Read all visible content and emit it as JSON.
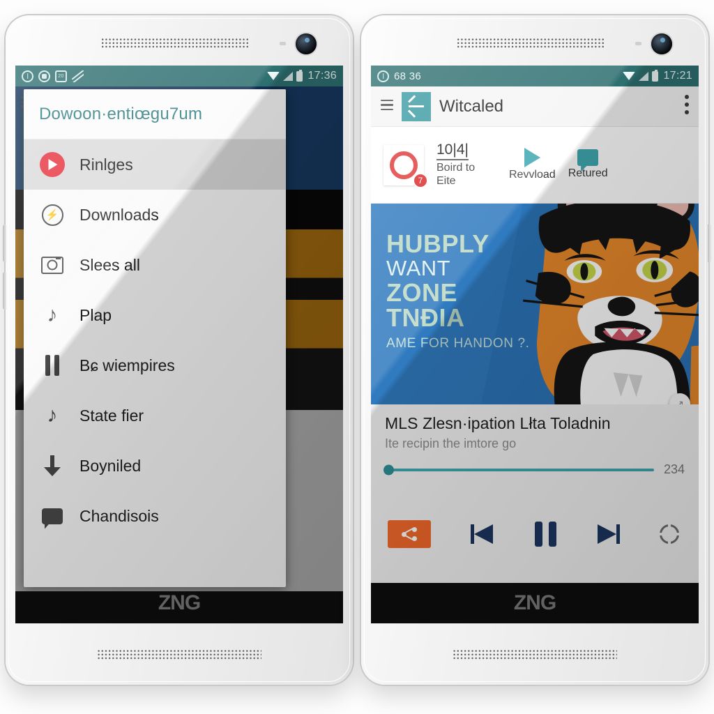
{
  "brand": "ZNG",
  "left_phone": {
    "status_bar": {
      "notification_icons": [
        "compass-icon",
        "sync-icon",
        "calendar-icon",
        "mute-icon"
      ],
      "wifi_icon": "wifi-icon",
      "signal_icon": "signal-icon",
      "battery_icon": "battery-icon",
      "time": "17:36"
    },
    "drawer": {
      "title": "Dowoon·entiœgu7um",
      "items": [
        {
          "label": "Rinlges",
          "icon": "play-circle-icon",
          "active": true
        },
        {
          "label": "Downloads",
          "icon": "bolt-circle-icon",
          "active": false
        },
        {
          "label": "Slees all",
          "icon": "camera-icon",
          "active": false
        },
        {
          "label": "Plap",
          "icon": "music-note-icon",
          "active": false
        },
        {
          "label": "Bɕ wiempires",
          "icon": "pause-icon",
          "active": false
        },
        {
          "label": "State fier",
          "icon": "music-note-icon",
          "active": false
        },
        {
          "label": "Boyniled",
          "icon": "download-arrow-icon",
          "active": false
        },
        {
          "label": "Chandisois",
          "icon": "chat-bubble-icon",
          "active": false
        }
      ]
    },
    "nav_bar": {
      "back": "back-triangle-icon",
      "home": "home-circle-icon",
      "recents": "recents-square-icon"
    }
  },
  "right_phone": {
    "status_bar": {
      "notification_icons": [
        "compass-icon"
      ],
      "notification_count": "68 36",
      "wifi_icon": "wifi-icon",
      "signal_icon": "signal-icon",
      "battery_icon": "battery-icon",
      "time": "17:21"
    },
    "toolbar": {
      "menu_icon": "hamburger-icon",
      "back_icon": "arrow-left-icon",
      "title": "Witcaled",
      "overflow_icon": "more-vertical-icon"
    },
    "action_row": {
      "thumbnail_icon": "red-loop-icon",
      "thumbnail_badge": "7",
      "primary_value": "10|4|",
      "primary_label": "Boird to Eite",
      "actions": [
        {
          "label": "Revvload",
          "icon": "play-triangle-icon"
        },
        {
          "label": "Retured",
          "icon": "chat-bubble-icon"
        }
      ]
    },
    "hero": {
      "lines": [
        "HUBPLY",
        "WANT",
        "ZONE",
        "TNÐIA"
      ],
      "caption": "AME FOR HANDON ?.",
      "fab_icon": "expand-icon",
      "image_subject": "tiger-illustration",
      "background_color": "#2b74b8"
    },
    "info": {
      "title": "MLS Zlesn·ipation Lłta Toladnin",
      "subtitle": "Ite recipin the imtore go",
      "seek_value": "234",
      "seek_progress_percent": 100
    },
    "controls": [
      {
        "name": "share-button",
        "icon": "share-icon",
        "color": "#f2692a"
      },
      {
        "name": "previous-button",
        "icon": "skip-previous-icon",
        "color": "#1b3560"
      },
      {
        "name": "pause-button",
        "icon": "pause-icon",
        "color": "#1b3560"
      },
      {
        "name": "next-button",
        "icon": "skip-next-icon",
        "color": "#1b3560"
      },
      {
        "name": "settings-button",
        "icon": "gear-icon",
        "color": "#6e6e6e"
      }
    ],
    "nav_bar": {
      "back": "back-triangle-icon",
      "home": "home-circle-icon",
      "recents": "recents-square-icon"
    }
  },
  "colors": {
    "status_bar_teal": "#2e6f70",
    "accent_teal": "#3fa8b0",
    "drawer_title_teal": "#2f7e82",
    "share_orange": "#f2692a",
    "control_navy": "#1b3560",
    "play_red": "#e8353f"
  }
}
